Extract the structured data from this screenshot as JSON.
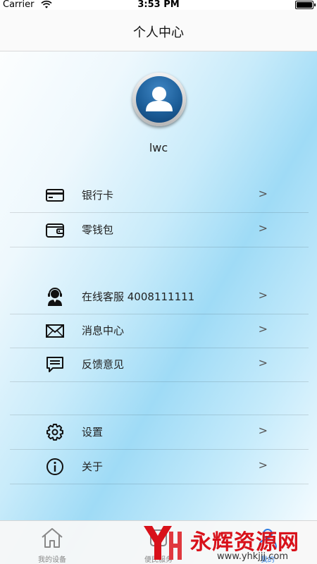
{
  "status": {
    "carrier": "Carrier",
    "time": "3:53 PM"
  },
  "header": {
    "title": "个人中心"
  },
  "profile": {
    "username": "lwc"
  },
  "menu": [
    {
      "label": "银行卡",
      "icon": "bank-card-icon"
    },
    {
      "label": "零钱包",
      "icon": "wallet-icon"
    },
    {
      "label": "在线客服 4008111111",
      "icon": "customer-service-icon"
    },
    {
      "label": "消息中心",
      "icon": "envelope-icon"
    },
    {
      "label": "反馈意见",
      "icon": "feedback-icon"
    },
    {
      "label": "设置",
      "icon": "gear-icon"
    },
    {
      "label": "关于",
      "icon": "info-icon"
    }
  ],
  "chevron": ">",
  "tabs": [
    {
      "label": "我的设备",
      "icon": "home-icon"
    },
    {
      "label": "便民服务",
      "icon": "service-icon"
    },
    {
      "label": "我的",
      "icon": "person-icon",
      "active": true
    }
  ],
  "watermark": {
    "text": "永辉资源网",
    "url": "www.yhkjjj.com"
  },
  "colors": {
    "accent": "#2f7de1",
    "watermark": "#d8111a",
    "avatar": "#1d5f9a"
  }
}
